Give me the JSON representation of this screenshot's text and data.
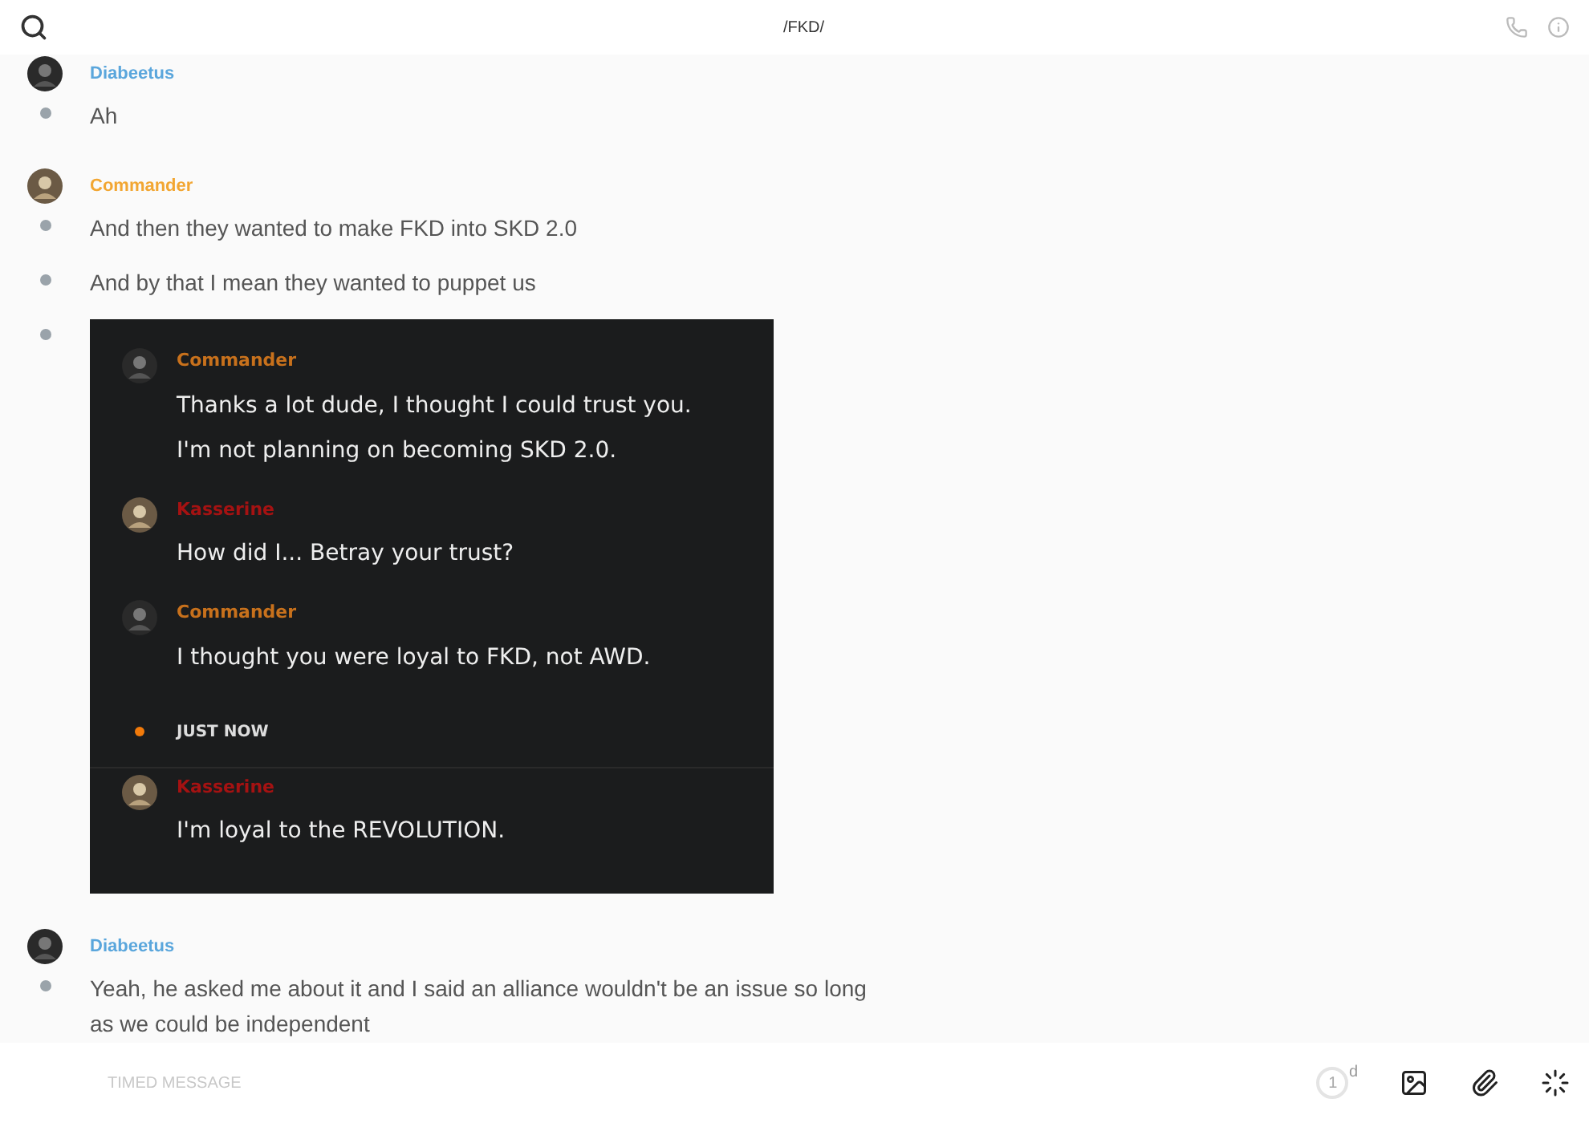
{
  "header": {
    "title": "/FKD/"
  },
  "groups": [
    {
      "author": "Diabeetus",
      "color": "#5aa6dc",
      "items": [
        {
          "kind": "text",
          "text": "Ah"
        }
      ]
    },
    {
      "author": "Commander",
      "color": "#f2a632",
      "items": [
        {
          "kind": "text",
          "text": "And then they wanted to make FKD into SKD 2.0"
        },
        {
          "kind": "text",
          "text": "And by that I mean they wanted to puppet us"
        },
        {
          "kind": "screenshot",
          "entries": [
            {
              "kind": "message",
              "author": "Commander",
              "color": "#c8711c",
              "lines": [
                "Thanks a lot dude, I thought I could trust you.",
                "I'm not planning on becoming SKD 2.0."
              ]
            },
            {
              "kind": "message",
              "author": "Kasserine",
              "color": "#a51212",
              "lines": [
                "How did I... Betray your trust?"
              ]
            },
            {
              "kind": "message",
              "author": "Commander",
              "color": "#c8711c",
              "lines": [
                "I thought you were loyal to FKD, not AWD."
              ]
            },
            {
              "kind": "divider",
              "label": "JUST NOW"
            },
            {
              "kind": "message",
              "author": "Kasserine",
              "color": "#a51212",
              "lines": [
                "I'm loyal to the REVOLUTION."
              ]
            }
          ]
        }
      ]
    },
    {
      "author": "Diabeetus",
      "color": "#5aa6dc",
      "items": [
        {
          "kind": "text",
          "text": "Yeah, he asked me about it and I said an alliance wouldn't be an issue so long as we could be independent"
        }
      ]
    }
  ],
  "composer": {
    "placeholder": "TIMED MESSAGE",
    "timer": "1",
    "timer_unit": "d"
  }
}
